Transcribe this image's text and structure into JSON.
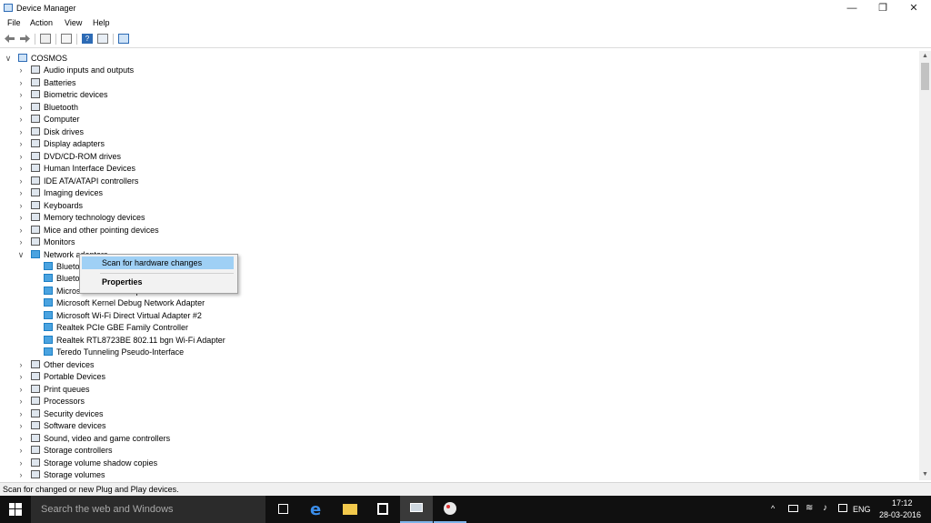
{
  "window": {
    "title": "Device Manager",
    "controls": {
      "minimize": "—",
      "maximize": "❐",
      "close": "✕"
    }
  },
  "menu": [
    "File",
    "Action",
    "View",
    "Help"
  ],
  "toolbar": {
    "icons": [
      "back-icon",
      "forward-icon",
      "show-hide-tree-icon",
      "properties-icon",
      "help-icon",
      "update-driver-icon",
      "scan-hardware-icon"
    ]
  },
  "tree": {
    "root": "COSMOS",
    "categories": [
      {
        "label": "Audio inputs and outputs",
        "icon": "speaker-icon"
      },
      {
        "label": "Batteries",
        "icon": "battery-icon"
      },
      {
        "label": "Biometric devices",
        "icon": "biometric-icon"
      },
      {
        "label": "Bluetooth",
        "icon": "bluetooth-icon"
      },
      {
        "label": "Computer",
        "icon": "computer-icon"
      },
      {
        "label": "Disk drives",
        "icon": "disk-drive-icon"
      },
      {
        "label": "Display adapters",
        "icon": "display-adapter-icon"
      },
      {
        "label": "DVD/CD-ROM drives",
        "icon": "dvd-icon"
      },
      {
        "label": "Human Interface Devices",
        "icon": "hid-icon"
      },
      {
        "label": "IDE ATA/ATAPI controllers",
        "icon": "ide-controller-icon"
      },
      {
        "label": "Imaging devices",
        "icon": "camera-icon"
      },
      {
        "label": "Keyboards",
        "icon": "keyboard-icon"
      },
      {
        "label": "Memory technology devices",
        "icon": "memory-icon"
      },
      {
        "label": "Mice and other pointing devices",
        "icon": "mouse-icon"
      },
      {
        "label": "Monitors",
        "icon": "monitor-icon"
      },
      {
        "label": "Network adapters",
        "icon": "network-adapter-icon"
      }
    ],
    "network_children": [
      "Bluetooth Device (Personal Area Network)",
      "Bluetooth Device (RFCOMM Protocol TDI)",
      "Microsoft ISATAP Adapter",
      "Microsoft Kernel Debug Network Adapter",
      "Microsoft Wi-Fi Direct Virtual Adapter #2",
      "Realtek PCIe GBE Family Controller",
      "Realtek RTL8723BE 802.11 bgn Wi-Fi Adapter",
      "Teredo Tunneling Pseudo-Interface"
    ],
    "categories_after": [
      {
        "label": "Other devices",
        "icon": "other-devices-icon"
      },
      {
        "label": "Portable Devices",
        "icon": "portable-device-icon"
      },
      {
        "label": "Print queues",
        "icon": "printer-icon"
      },
      {
        "label": "Processors",
        "icon": "processor-icon"
      },
      {
        "label": "Security devices",
        "icon": "security-icon"
      },
      {
        "label": "Software devices",
        "icon": "software-device-icon"
      },
      {
        "label": "Sound, video and game controllers",
        "icon": "sound-icon"
      },
      {
        "label": "Storage controllers",
        "icon": "storage-controller-icon"
      },
      {
        "label": "Storage volume shadow copies",
        "icon": "shadow-copy-icon"
      },
      {
        "label": "Storage volumes",
        "icon": "storage-volume-icon"
      }
    ]
  },
  "context_menu": {
    "items": [
      "Scan for hardware changes",
      "Properties"
    ],
    "highlighted": "Scan for hardware changes"
  },
  "status_bar": {
    "text": "Scan for changed or new Plug and Play devices."
  },
  "taskbar": {
    "search_placeholder": "Search the web and Windows",
    "apps": [
      "task-view-icon",
      "edge-icon",
      "file-explorer-icon",
      "store-icon",
      "device-manager-icon",
      "paint-icon"
    ],
    "tray": {
      "language": "ENG",
      "time": "17:12",
      "date": "28-03-2016"
    }
  },
  "colors": {
    "highlight": "#9fd0f5",
    "taskbar": "#101010",
    "search_box": "#2b2b2b",
    "accent": "#2d6bb5"
  }
}
